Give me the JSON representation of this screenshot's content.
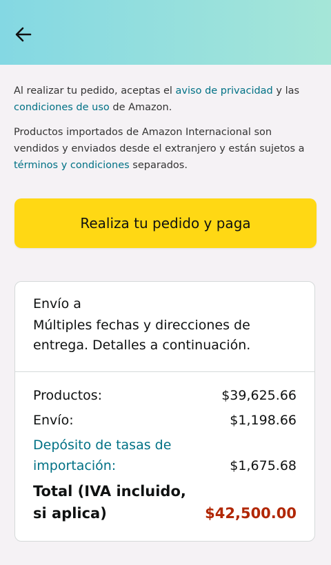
{
  "legal": {
    "p1": {
      "pre": "Al realizar tu pedido, aceptas el ",
      "link1": "aviso de privacidad",
      "mid": " y las ",
      "link2": "condiciones de uso",
      "post": " de Amazon."
    },
    "p2": {
      "pre": "Productos importados de Amazon Internacional son vendidos y enviados desde el extranjero y están sujetos a ",
      "link": "términos y condiciones",
      "post": " separados."
    }
  },
  "cta": {
    "label": "Realiza tu pedido y paga"
  },
  "shipping": {
    "label": "Envío a",
    "value": "Múltiples fechas y direcciones de entrega. Detalles a continuación."
  },
  "summary": {
    "products": {
      "label": "Productos:",
      "value": "$39,625.66"
    },
    "shipping": {
      "label": "Envío:",
      "value": "$1,198.66"
    },
    "import_fees": {
      "label": "Depósito de tasas de importación:",
      "value": "$1,675.68"
    },
    "total": {
      "label": "Total (IVA incluido, si aplica)",
      "value": "$42,500.00"
    }
  },
  "colors": {
    "header_gradient": [
      "#84d8e3",
      "#a5e6d8"
    ],
    "button": "#ffd814",
    "link": "#007185",
    "total_price": "#b12704"
  },
  "icons": {
    "back": "arrow-left-icon"
  }
}
